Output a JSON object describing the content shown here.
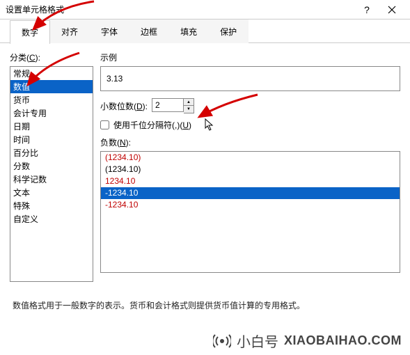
{
  "title": "设置单元格格式",
  "help_symbol": "?",
  "tabs": [
    "数字",
    "对齐",
    "字体",
    "边框",
    "填充",
    "保护"
  ],
  "active_tab": 0,
  "category_label_pre": "分类(",
  "category_label_u": "C",
  "category_label_post": "):",
  "categories": [
    "常规",
    "数值",
    "货币",
    "会计专用",
    "日期",
    "时间",
    "百分比",
    "分数",
    "科学记数",
    "文本",
    "特殊",
    "自定义"
  ],
  "selected_category": 1,
  "example_label": "示例",
  "example_value": "3.13",
  "decimals_label_pre": "小数位数(",
  "decimals_label_u": "D",
  "decimals_label_post": "):",
  "decimals_value": "2",
  "thousands_label_pre": "使用千位分隔符(,)(",
  "thousands_label_u": "U",
  "thousands_label_post": ")",
  "negatives_label_pre": "负数(",
  "negatives_label_u": "N",
  "negatives_label_post": "):",
  "negatives": [
    {
      "text": "(1234.10)",
      "red": true,
      "selected": false
    },
    {
      "text": "(1234.10)",
      "red": false,
      "selected": false
    },
    {
      "text": "1234.10",
      "red": true,
      "selected": false
    },
    {
      "text": "-1234.10",
      "red": false,
      "selected": true
    },
    {
      "text": "-1234.10",
      "red": true,
      "selected": false
    }
  ],
  "description": "数值格式用于一般数字的表示。货币和会计格式则提供货币值计算的专用格式。",
  "watermark_cn": "小白号",
  "watermark_en": "XIAOBAIHAO.COM"
}
